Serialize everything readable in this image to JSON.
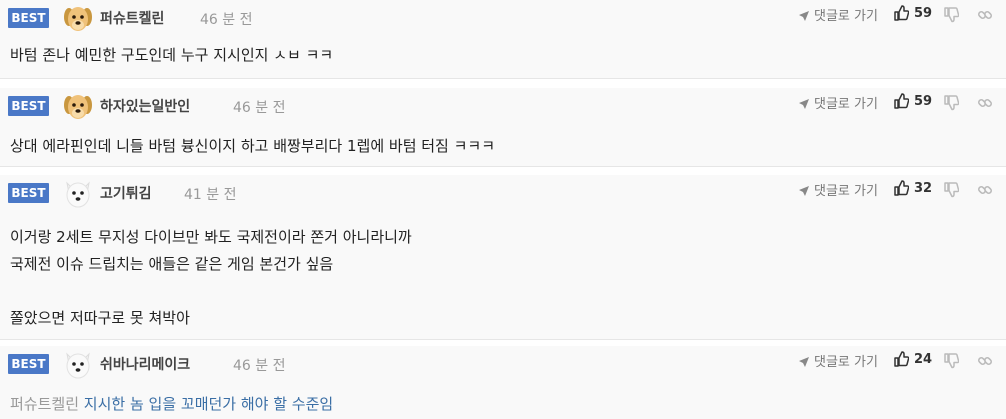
{
  "common": {
    "badge": "BEST",
    "reply_label": "댓글로 가기"
  },
  "comments": [
    {
      "nickname": "퍼슈트켈린",
      "time": "46 분 전",
      "likes": "59",
      "avatar": "dog",
      "lines": [
        "바텀 존나 예민한 구도인데 누구 지시인지 ㅅㅂ ㅋㅋ"
      ]
    },
    {
      "nickname": "하자있는일반인",
      "time": "46 분 전",
      "likes": "59",
      "avatar": "dog",
      "lines": [
        "상대 에라핀인데 니들 바텀 븅신이지 하고 배짱부리다 1렙에 바텀 터짐 ㅋㅋㅋ"
      ]
    },
    {
      "nickname": "고기튀김",
      "time": "41 분 전",
      "likes": "32",
      "avatar": "white-dog",
      "lines": [
        "이거랑 2세트 무지성 다이브만 봐도 국제전이라 쫀거 아니라니까",
        "국제전 이슈 드립치는 애들은 같은 게임 본건가 싶음",
        "",
        "쫄았으면 저따구로 못 쳐박아"
      ]
    },
    {
      "nickname": "쉬바나리메이크",
      "time": "46 분 전",
      "likes": "24",
      "avatar": "white-dog",
      "mention": "퍼슈트켈린",
      "lines": [
        "지시한 놈 입을 꼬매던가 해야 할 수준임"
      ]
    }
  ]
}
